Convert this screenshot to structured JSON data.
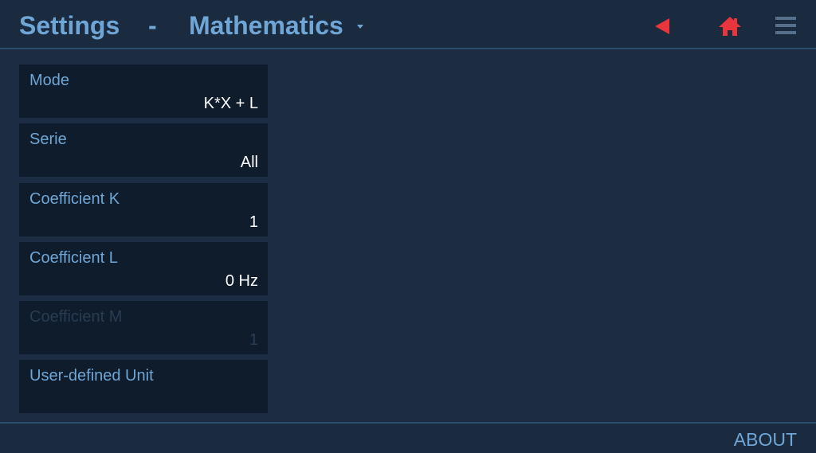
{
  "header": {
    "title": "Settings",
    "separator": "-",
    "section": "Mathematics",
    "icons": {
      "dropdown": "chevron-down-icon",
      "back": "back-arrow-icon",
      "home": "home-icon",
      "menu": "hamburger-menu-icon"
    },
    "accent_color": "#e8363c",
    "title_color": "#6fa6d6"
  },
  "settings": [
    {
      "label": "Mode",
      "value": "K*X + L",
      "enabled": true
    },
    {
      "label": "Serie",
      "value": "All",
      "enabled": true
    },
    {
      "label": "Coefficient K",
      "value": "1",
      "enabled": true
    },
    {
      "label": "Coefficient L",
      "value": "0 Hz",
      "enabled": true
    },
    {
      "label": "Coefficient M",
      "value": "1",
      "enabled": false
    },
    {
      "label": "User-defined Unit",
      "value": "",
      "enabled": true
    }
  ],
  "footer": {
    "about": "ABOUT"
  }
}
